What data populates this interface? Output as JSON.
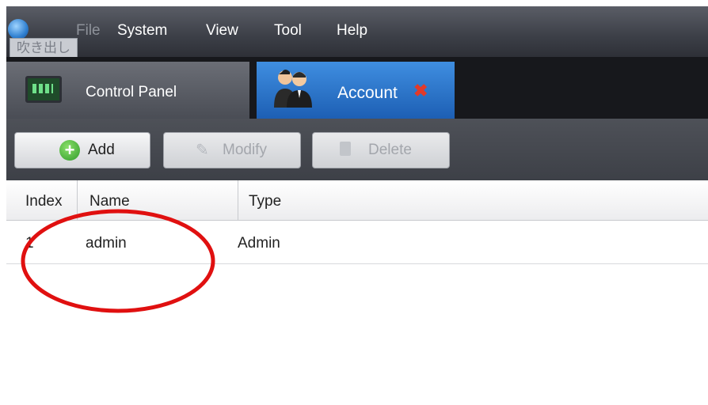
{
  "app": {
    "tooltip_text": "吹き出し"
  },
  "menubar": {
    "items": [
      "File",
      "System",
      "View",
      "Tool",
      "Help"
    ]
  },
  "tabs": [
    {
      "label": "Control Panel",
      "icon": "monitor-icon",
      "active": false
    },
    {
      "label": "Account",
      "icon": "people-icon",
      "active": true,
      "closable": true
    }
  ],
  "toolbar": {
    "add_label": "Add",
    "modify_label": "Modify",
    "delete_label": "Delete"
  },
  "table": {
    "columns": [
      "Index",
      "Name",
      "Type"
    ],
    "rows": [
      {
        "index": "1",
        "name": "admin",
        "type": "Admin"
      }
    ]
  },
  "colors": {
    "active_tab": "#2f7ad0",
    "annotation": "#e01010",
    "close_x": "#e23a2a"
  }
}
